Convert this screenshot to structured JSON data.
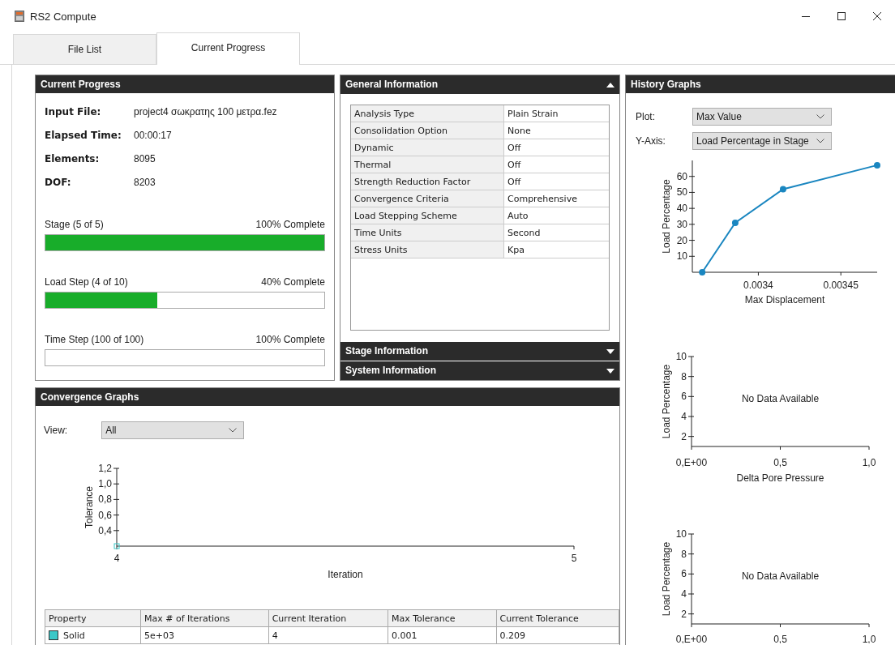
{
  "window": {
    "title": "RS2 Compute"
  },
  "tabs": [
    {
      "label": "File List",
      "selected": false
    },
    {
      "label": "Current Progress",
      "selected": true
    }
  ],
  "current_progress": {
    "title": "Current Progress",
    "fields": [
      {
        "label": "Input File:",
        "value": "project4 σωκρατης 100 μετρα.fez"
      },
      {
        "label": "Elapsed Time:",
        "value": "00:00:17"
      },
      {
        "label": "Elements:",
        "value": "8095"
      },
      {
        "label": "DOF:",
        "value": "8203"
      }
    ],
    "progress": [
      {
        "label": "Stage (5 of 5)",
        "reading": "100% Complete",
        "level": 1
      },
      {
        "label": "Load Step (4 of 10)",
        "reading": "40% Complete",
        "level": 0.4
      },
      {
        "label": "Time Step (100 of 100)",
        "reading": "100% Complete",
        "level": 0
      }
    ]
  },
  "information_sections": [
    {
      "title": "General Information",
      "expanded": true,
      "rows": [
        {
          "name": "Analysis Type",
          "value": "Plain Strain"
        },
        {
          "name": "Consolidation Option",
          "value": "None"
        },
        {
          "name": "Dynamic",
          "value": "Off"
        },
        {
          "name": "Thermal",
          "value": "Off"
        },
        {
          "name": "Strength Reduction Factor",
          "value": "Off"
        },
        {
          "name": "Convergence Criteria",
          "value": "Comprehensive"
        },
        {
          "name": "Load Stepping Scheme",
          "value": "Auto"
        },
        {
          "name": "Time Units",
          "value": "Second"
        },
        {
          "name": "Stress Units",
          "value": "Kpa"
        }
      ]
    },
    {
      "title": "Stage Information",
      "expanded": false
    },
    {
      "title": "System Information",
      "expanded": false
    }
  ],
  "history_graphs": {
    "title": "History Graphs",
    "controls": [
      {
        "label": "Plot:",
        "value": "Max Value"
      },
      {
        "label": "Y-Axis:",
        "value": "Load Percentage in Stage"
      }
    ],
    "charts": [
      {
        "chart_data": {
          "type": "line",
          "xlabel": "Max Displacement",
          "ylabel": "Load Percentage",
          "x": [
            0.003366,
            0.003386,
            0.003415,
            0.003472
          ],
          "series": [
            {
              "color": "#1a86c0",
              "marker": "circle",
              "values": [
                0,
                31,
                52,
                67
              ]
            }
          ],
          "xlim": [
            0.00336,
            0.003472
          ],
          "ylim": [
            0,
            70
          ],
          "xticks": [
            0.0034,
            0.00345
          ],
          "yticks": [
            10,
            20,
            30,
            40,
            50,
            60
          ]
        }
      },
      {
        "message": "No Data Available",
        "chart_data": {
          "type": "line",
          "xlabel": "Delta Pore Pressure",
          "ylabel": "Load Percentage",
          "xlim": [
            0,
            1
          ],
          "ylim": [
            1,
            10
          ],
          "xticks": [
            {
              "value": 0,
              "label": "0,E+00"
            },
            {
              "value": 0.5,
              "label": "0,5"
            },
            {
              "value": 1,
              "label": "1,0"
            }
          ],
          "yticks": [
            2,
            4,
            6,
            8,
            10
          ]
        }
      },
      {
        "message": "No Data Available",
        "chart_data": {
          "type": "line",
          "ylabel": "Load Percentage",
          "xlim": [
            0,
            1
          ],
          "ylim": [
            1,
            10
          ],
          "xticks": [
            {
              "value": 0,
              "label": "0,E+00"
            },
            {
              "value": 0.5,
              "label": "0,5"
            },
            {
              "value": 1,
              "label": "1,0"
            }
          ],
          "yticks": [
            2,
            4,
            6,
            8,
            10
          ]
        }
      }
    ]
  },
  "convergence_graphs": {
    "title": "Convergence Graphs",
    "view": {
      "label": "View:",
      "value": "All"
    },
    "chart_data": {
      "type": "line",
      "xlabel": "Iteration",
      "ylabel": "Tolerance",
      "x": [
        4
      ],
      "series": [
        {
          "color": "#3cc8c8",
          "marker": "square",
          "values": [
            0.2
          ]
        }
      ],
      "xlim": [
        4,
        5
      ],
      "ylim": [
        0.2,
        1.2
      ],
      "xticks": [
        4,
        5
      ],
      "yticks": [
        {
          "value": 0.4,
          "label": "0,4"
        },
        {
          "value": 0.6,
          "label": "0,6"
        },
        {
          "value": 0.8,
          "label": "0,8"
        },
        {
          "value": 1.0,
          "label": "1,0"
        },
        {
          "value": 1.2,
          "label": "1,2"
        }
      ]
    },
    "table": {
      "columns": [
        "Property",
        "Max # of Iterations",
        "Current Iteration",
        "Max Tolerance",
        "Current Tolerance"
      ],
      "rows": [
        {
          "color": "#3cc8c8",
          "cells": [
            "Solid",
            "5e+03",
            "4",
            "0.001",
            "0.209"
          ]
        }
      ]
    }
  }
}
